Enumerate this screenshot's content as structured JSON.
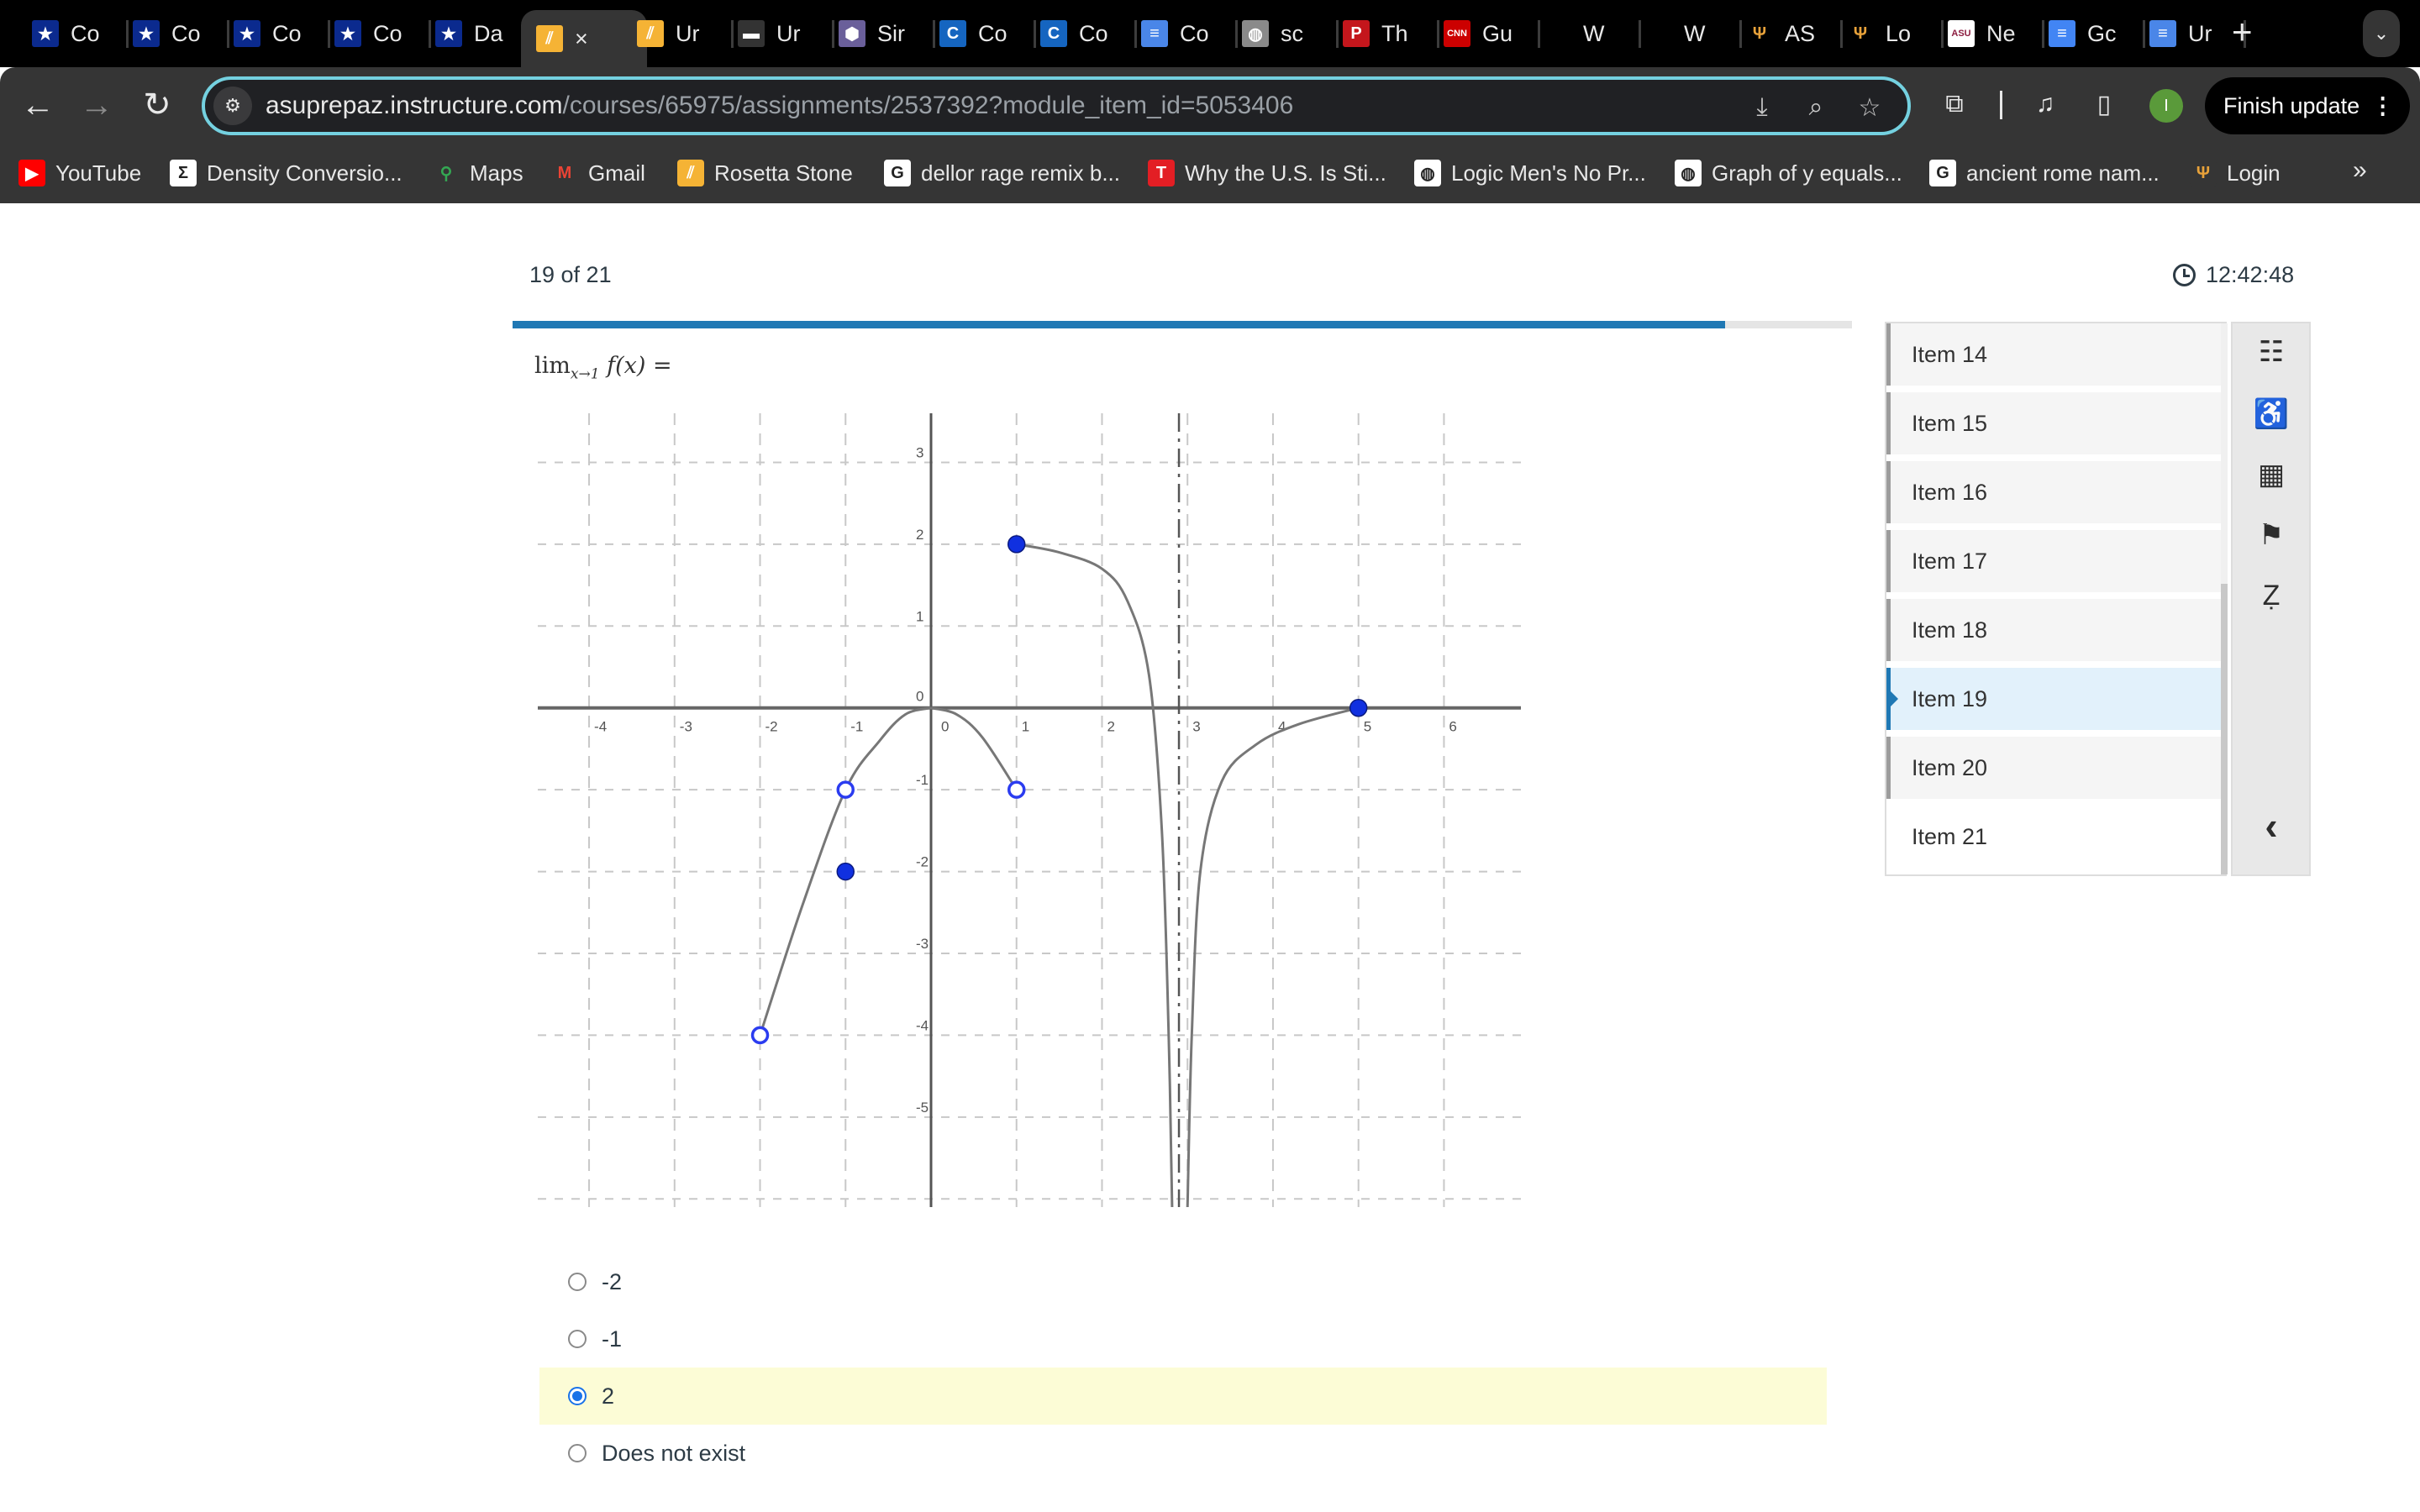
{
  "browser": {
    "tabs": [
      {
        "label": "Co",
        "icon": "star-shield-icon",
        "color": "#0b2a8e"
      },
      {
        "label": "Co",
        "icon": "star-shield-icon",
        "color": "#0b2a8e"
      },
      {
        "label": "Co",
        "icon": "star-shield-icon",
        "color": "#0b2a8e"
      },
      {
        "label": "Co",
        "icon": "star-shield-icon",
        "color": "#0b2a8e"
      },
      {
        "label": "Da",
        "icon": "star-shield-icon",
        "color": "#0b2a8e"
      },
      {
        "label": "×",
        "icon": "instructure-icon",
        "color": "#f5b335",
        "active": true
      },
      {
        "label": "Ur",
        "icon": "instructure-icon",
        "color": "#f5b335"
      },
      {
        "label": "Ur",
        "icon": "rainbow-icon",
        "color": "#333333"
      },
      {
        "label": "Sir",
        "icon": "hex-cluster-icon",
        "color": "#6a5f9a"
      },
      {
        "label": "Co",
        "icon": "c-circle-icon",
        "color": "#1565c0"
      },
      {
        "label": "Co",
        "icon": "c-circle-icon",
        "color": "#1565c0"
      },
      {
        "label": "Co",
        "icon": "docs-icon",
        "color": "#4a86e8"
      },
      {
        "label": "sc",
        "icon": "globe-icon",
        "color": "#8a8a8a"
      },
      {
        "label": "Th",
        "icon": "p-icon",
        "color": "#c4161c"
      },
      {
        "label": "Gu",
        "icon": "cnn-icon",
        "color": "#cc0000"
      },
      {
        "label": "W",
        "icon": "blank-icon",
        "color": "#000000"
      },
      {
        "label": "W",
        "icon": "blank-icon",
        "color": "#000000"
      },
      {
        "label": "AS",
        "icon": "pitchfork-icon",
        "color": "#000000"
      },
      {
        "label": "Lo",
        "icon": "pitchfork-icon",
        "color": "#000000"
      },
      {
        "label": "Ne",
        "icon": "asu-icon",
        "color": "#ffffff"
      },
      {
        "label": "Gc",
        "icon": "google-docs-icon",
        "color": "#4285f4"
      },
      {
        "label": "Ur",
        "icon": "docs-icon",
        "color": "#4a86e8"
      }
    ],
    "url_domain": "asuprepaz.instructure.com",
    "url_path": "/courses/65975/assignments/2537392?module_item_id=5053406",
    "profile_initial": "I",
    "finish_update_label": "Finish update",
    "bookmarks": [
      {
        "label": "YouTube",
        "icon": "youtube-icon",
        "color": "#ff0000"
      },
      {
        "label": "Density Conversio...",
        "icon": "sigma-icon",
        "color": "#ffffff"
      },
      {
        "label": "Maps",
        "icon": "maps-pin-icon",
        "color": "#34a853"
      },
      {
        "label": "Gmail",
        "icon": "gmail-icon",
        "color": "#ea4335"
      },
      {
        "label": "Rosetta Stone",
        "icon": "instructure-icon",
        "color": "#f5b335"
      },
      {
        "label": "dellor rage remix b...",
        "icon": "google-icon",
        "color": "#ffffff"
      },
      {
        "label": "Why the U.S. Is Sti...",
        "icon": "t-icon",
        "color": "#e31e24"
      },
      {
        "label": "Logic Men's No Pr...",
        "icon": "globe-icon",
        "color": "#ffffff"
      },
      {
        "label": "Graph of y equals...",
        "icon": "globe-icon",
        "color": "#ffffff"
      },
      {
        "label": "ancient rome nam...",
        "icon": "google-icon",
        "color": "#ffffff"
      },
      {
        "label": "Login",
        "icon": "pitchfork-icon",
        "color": "#353535"
      }
    ]
  },
  "quiz": {
    "counter": "19 of 21",
    "timer": "12:42:48",
    "progress_fraction": 0.905,
    "question": {
      "lim": "lim",
      "sub": "x→1",
      "expr": "f(x) ="
    },
    "answers": [
      {
        "label": "-2",
        "selected": false
      },
      {
        "label": "-1",
        "selected": false
      },
      {
        "label": "2",
        "selected": true
      },
      {
        "label": "Does not exist",
        "selected": false
      }
    ],
    "items": [
      {
        "label": "Item 14"
      },
      {
        "label": "Item 15"
      },
      {
        "label": "Item 16"
      },
      {
        "label": "Item 17"
      },
      {
        "label": "Item 18"
      },
      {
        "label": "Item 19",
        "current": true
      },
      {
        "label": "Item 20"
      },
      {
        "label": "Item 21"
      }
    ],
    "tools": [
      {
        "name": "item-list-icon",
        "glyph": "☷"
      },
      {
        "name": "accessibility-icon",
        "glyph": "♿"
      },
      {
        "name": "calculator-icon",
        "glyph": "▦"
      },
      {
        "name": "flag-icon",
        "glyph": "⚑"
      },
      {
        "name": "eliminate-icon",
        "glyph": "Ẓ"
      },
      {
        "name": "collapse-chevron-icon",
        "glyph": "‹"
      }
    ]
  },
  "chart_data": {
    "type": "line",
    "title": "",
    "xlabel": "",
    "ylabel": "",
    "xlim": [
      -4.6,
      6.9
    ],
    "ylim": [
      -6.1,
      3.6
    ],
    "grid": true,
    "x_ticks": [
      -4,
      -3,
      -2,
      -1,
      0,
      1,
      2,
      3,
      4,
      5,
      6
    ],
    "y_ticks": [
      3,
      2,
      1,
      0,
      -1,
      -2,
      -3,
      -4,
      -5
    ],
    "vertical_asymptote": 2.9,
    "pieces": [
      {
        "name": "left-rising-curve",
        "points": [
          [
            -2,
            -4
          ],
          [
            -1.5,
            -2.4
          ],
          [
            -1,
            -1
          ],
          [
            -0.6,
            -0.4
          ],
          [
            -0.3,
            -0.08
          ],
          [
            0,
            0
          ]
        ]
      },
      {
        "name": "middle-parabola",
        "points": [
          [
            0,
            0
          ],
          [
            0.3,
            -0.08
          ],
          [
            0.6,
            -0.36
          ],
          [
            1,
            -1
          ]
        ]
      },
      {
        "name": "upper-curve-to-asymptote",
        "points": [
          [
            1,
            2
          ],
          [
            1.5,
            1.9
          ],
          [
            2,
            1.7
          ],
          [
            2.3,
            1.3
          ],
          [
            2.55,
            0.4
          ],
          [
            2.7,
            -1.5
          ],
          [
            2.78,
            -4
          ],
          [
            2.82,
            -6.1
          ]
        ]
      },
      {
        "name": "right-curve-from-asymptote",
        "points": [
          [
            3.0,
            -6.1
          ],
          [
            3.05,
            -4
          ],
          [
            3.15,
            -2
          ],
          [
            3.4,
            -0.9
          ],
          [
            3.8,
            -0.45
          ],
          [
            4.3,
            -0.2
          ],
          [
            5,
            0
          ]
        ]
      }
    ],
    "points": [
      {
        "x": -2,
        "y": -4,
        "filled": false
      },
      {
        "x": -1,
        "y": -1,
        "filled": false
      },
      {
        "x": -1,
        "y": -2,
        "filled": true
      },
      {
        "x": 1,
        "y": -1,
        "filled": false
      },
      {
        "x": 1,
        "y": 2,
        "filled": true
      },
      {
        "x": 5,
        "y": 0,
        "filled": true
      }
    ]
  }
}
